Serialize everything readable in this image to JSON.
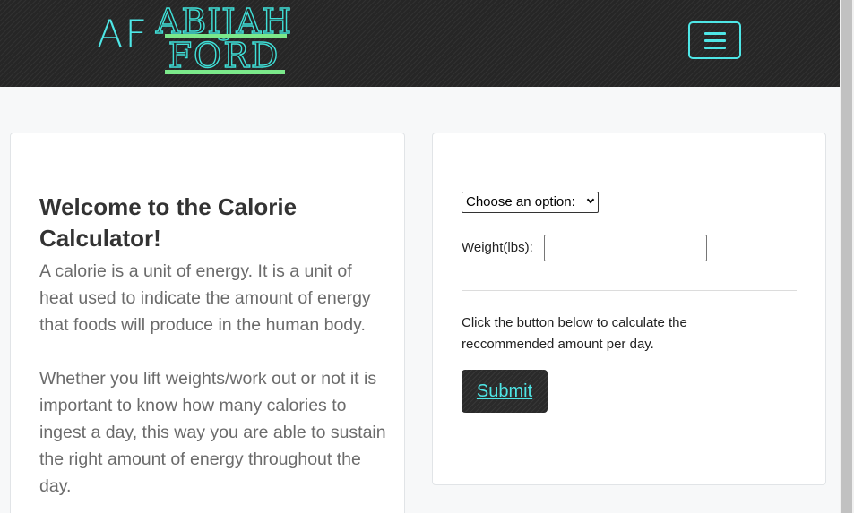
{
  "header": {
    "logo_initials": "AF",
    "logo_first_name": "ABIJAH",
    "logo_last_name": "FORD",
    "menu_icon": "hamburger-icon"
  },
  "intro": {
    "title": "Welcome to the Calorie Calculator!",
    "paragraph_1": "A calorie is a unit of energy. It is a unit of heat used to indicate the amount of energy that foods will produce in the human body.",
    "paragraph_2": "Whether you lift weights/work out or not it is important to know how many calories to ingest a day, this way you are able to sustain the right amount of energy throughout the day."
  },
  "form": {
    "select_value": "Choose an option:",
    "weight_label": "Weight(lbs):",
    "weight_value": "",
    "instructions": "Click the button below to calculate the reccommended amount per day.",
    "submit_label": "Submit"
  },
  "colors": {
    "accent": "#4ee6e6",
    "underline_green": "#7be88a",
    "navbar_bg": "#262626"
  }
}
